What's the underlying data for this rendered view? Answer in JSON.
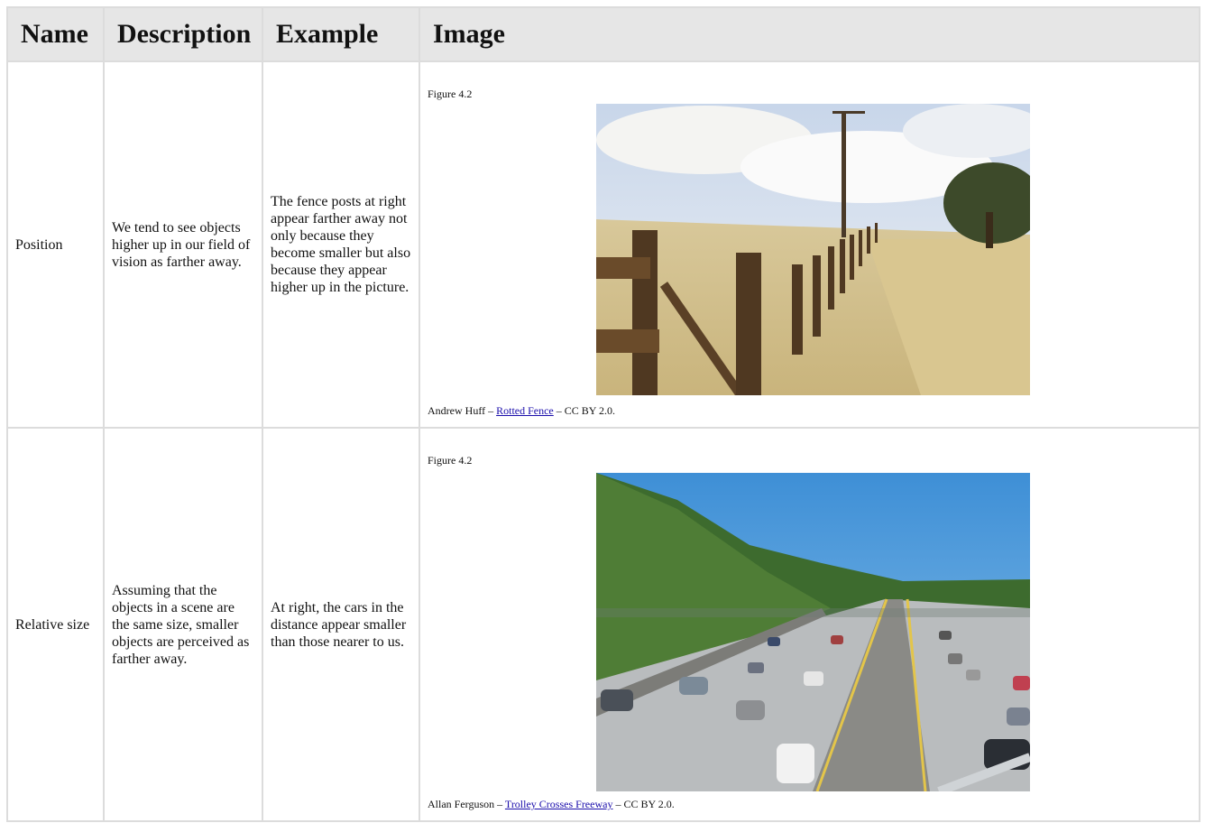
{
  "table": {
    "headers": [
      "Name",
      "Description",
      "Example",
      "Image"
    ],
    "rows": [
      {
        "name": "Position",
        "description": "We tend to see objects higher up in our field of vision as farther away.",
        "example": "The fence posts at right appear farther away not only because they become smaller but also because they appear higher up in the picture.",
        "figure_label": "Figure 4.2",
        "credit_author": "Andrew Huff – ",
        "credit_link": "Rotted Fence",
        "credit_license": " – CC BY 2.0."
      },
      {
        "name": "Relative size",
        "description": "Assuming that the objects in a scene are the same size, smaller objects are perceived as farther away.",
        "example": "At right, the cars in the distance appear smaller than those nearer to us.",
        "figure_label": "Figure 4.2",
        "credit_author": "Allan Ferguson – ",
        "credit_link": "Trolley Crosses Freeway",
        "credit_license": " – CC BY 2.0."
      }
    ]
  }
}
